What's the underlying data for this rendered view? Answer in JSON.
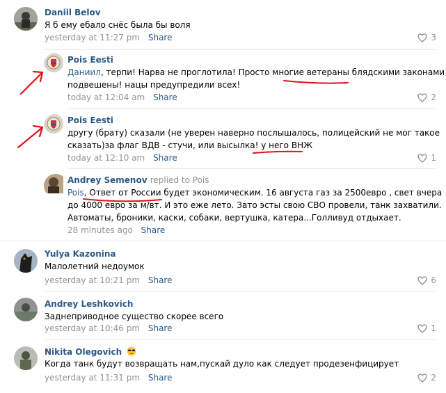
{
  "comments": [
    {
      "author": "Daniil Belov",
      "text": "Я б ему ебало снёс была бы воля",
      "time": "yesterday at 11:27 pm",
      "share": "Share",
      "likes": "3"
    },
    {
      "author": "Pois Eesti",
      "mention": "Даниил",
      "line1": ", терпи! Нарва не проглотила! Просто многие ветераны блядскими законами",
      "line2": "подвешены! нацы предупредили всех!",
      "time": "today at 12:04 am",
      "share": "Share",
      "likes": "2"
    },
    {
      "author": "Pois Eesti",
      "line1": "другу (брату) сказали (не уверен наверно послышалось, полицейский не мог такое",
      "line2": "сказать)за флаг ВДВ - стучи, или высылка! у него ВНЖ",
      "time": "today at 12:10 am",
      "share": "Share",
      "likes": "1"
    },
    {
      "author": "Andrey Semenov",
      "replied": "replied to Pois",
      "mention": "Pois",
      "line1": ", Ответ от России будет экономическим. 16 августа газ за 2500евро , свет вчера",
      "line2": "до 4000 евро за м/вт. И это еже лето. Зато эсты свою СВО провели, танк захватили.",
      "line3": "Автоматы, броники, каски, собаки, вертушка, катера...Голливуд отдыхает.",
      "time": "28 minutes ago",
      "share": "Share"
    },
    {
      "author": "Yulya Kazonina",
      "text": "Малолетний недоумок",
      "time": "yesterday at 10:21 pm",
      "share": "Share",
      "likes": "6"
    },
    {
      "author": "Andrey Leshkovich",
      "text": "Заднеприводное существо скорее всего",
      "time": "yesterday at 10:46 pm",
      "share": "Share",
      "likes": "1"
    },
    {
      "author": "Nikita Olegovich",
      "text": "Когда танк будут возвращать нам,пускай дуло как следует продезенфицирует",
      "time": "yesterday at 11:31 pm",
      "share": "Share",
      "likes": "2"
    }
  ],
  "icons": {
    "like": "heart-icon",
    "emoji": "sunglasses-emoji-icon",
    "annotation": "red-arrow"
  },
  "colors": {
    "link": "#2a5885",
    "meta": "#939393",
    "annotation": "#e0101a"
  }
}
